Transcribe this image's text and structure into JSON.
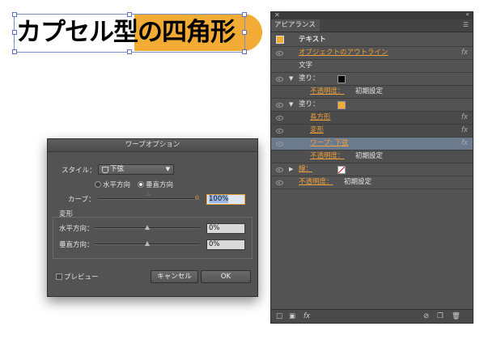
{
  "artwork": {
    "text": "カプセル型の四角形",
    "shape_color": "#f2ac36"
  },
  "warp_dialog": {
    "title": "ワープオプション",
    "style_label": "スタイル：",
    "style_value": "下弦",
    "horizontal_label": "水平方向",
    "vertical_label": "垂直方向",
    "bend_label": "カーブ：",
    "bend_value": "100%",
    "distortion_label": "変形",
    "h_dist_label": "水平方向：",
    "h_dist_value": "0%",
    "v_dist_label": "垂直方向：",
    "v_dist_value": "0%",
    "preview_label": "プレビュー",
    "cancel_label": "キャンセル",
    "ok_label": "OK"
  },
  "appearance_panel": {
    "title": "アピアランス",
    "rows": [
      {
        "label": "テキスト"
      },
      {
        "label": "オブジェクトのアウトライン",
        "fx": "fx"
      },
      {
        "label": "文字"
      },
      {
        "label": "塗り：",
        "swatch": "#000000"
      },
      {
        "label": "不透明度：",
        "value": "初期設定"
      },
      {
        "label": "塗り：",
        "swatch": "#f2ac36"
      },
      {
        "label": "長方形",
        "fx": "fx"
      },
      {
        "label": "変形",
        "fx": "fx"
      },
      {
        "label": "ワープ: 下弦",
        "fx": "fx"
      },
      {
        "label": "不透明度：",
        "value": "初期設定"
      },
      {
        "label": "線：",
        "swatch": "none"
      },
      {
        "label": "不透明度：",
        "value": "初期設定"
      }
    ],
    "footer_fx": "fx"
  }
}
